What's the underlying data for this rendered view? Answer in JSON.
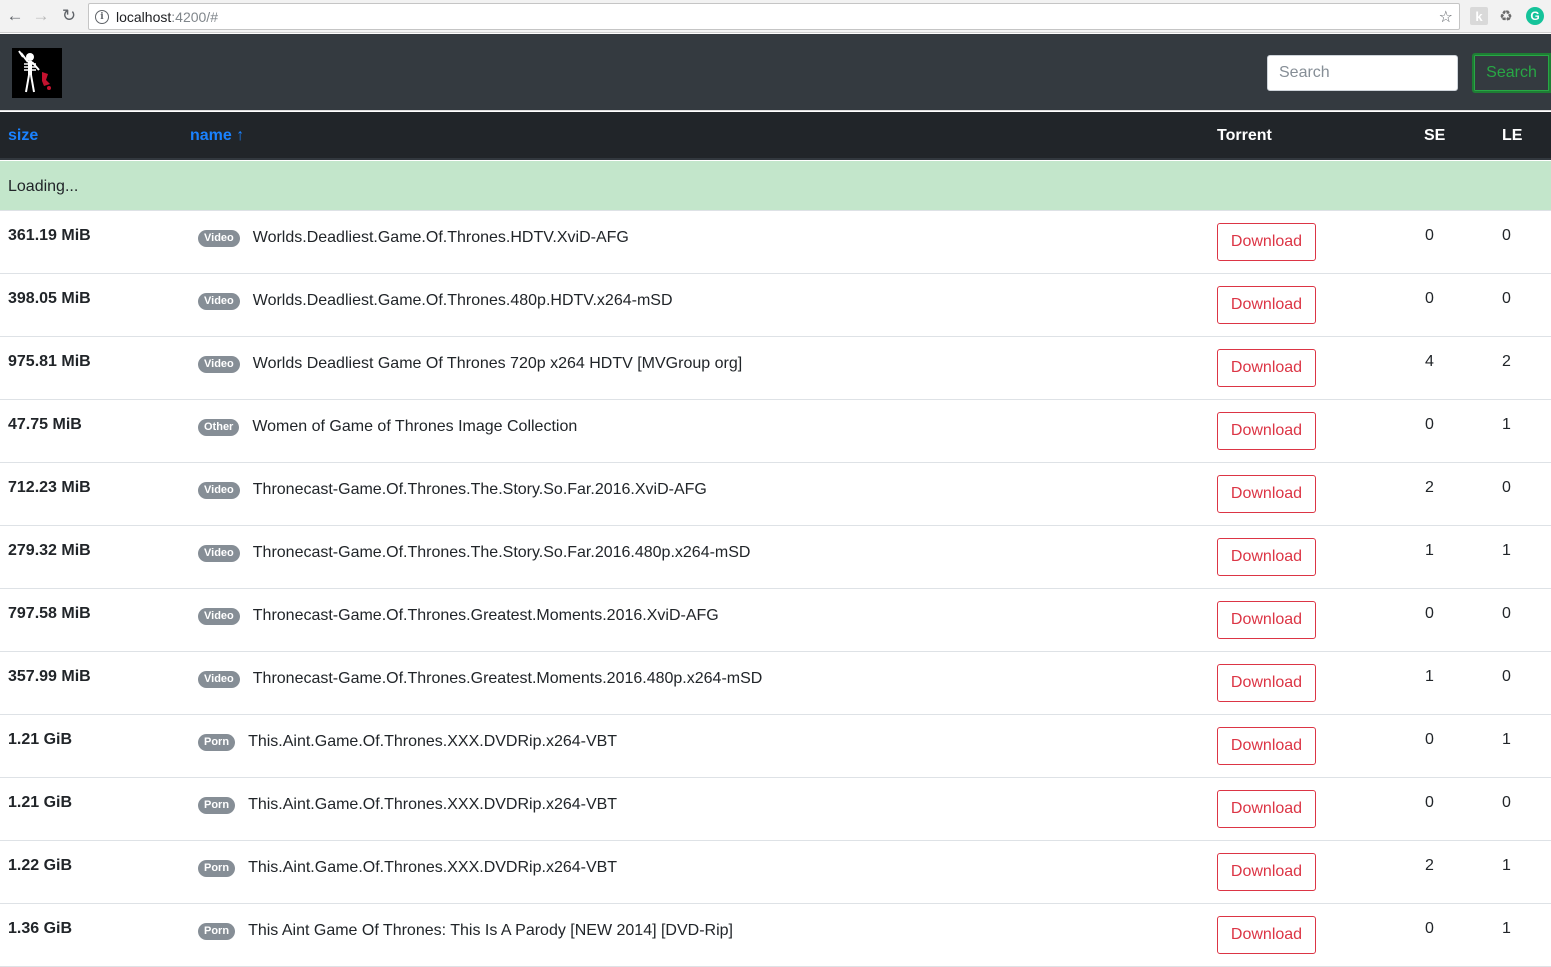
{
  "browser": {
    "url_host": "localhost",
    "url_path": ":4200/#"
  },
  "navbar": {
    "search_placeholder": "Search",
    "search_button": "Search"
  },
  "table": {
    "headers": {
      "size": "size",
      "name": "name ↑",
      "torrent": "Torrent",
      "se": "SE",
      "le": "LE"
    },
    "loading": "Loading...",
    "download_label": "Download",
    "rows": [
      {
        "size": "361.19 MiB",
        "category": "Video",
        "name": "Worlds.Deadliest.Game.Of.Thrones.HDTV.XviD-AFG",
        "se": "0",
        "le": "0"
      },
      {
        "size": "398.05 MiB",
        "category": "Video",
        "name": "Worlds.Deadliest.Game.Of.Thrones.480p.HDTV.x264-mSD",
        "se": "0",
        "le": "0"
      },
      {
        "size": "975.81 MiB",
        "category": "Video",
        "name": "Worlds Deadliest Game Of Thrones 720p x264 HDTV [MVGroup org]",
        "se": "4",
        "le": "2"
      },
      {
        "size": "47.75 MiB",
        "category": "Other",
        "name": "Women of Game of Thrones Image Collection",
        "se": "0",
        "le": "1"
      },
      {
        "size": "712.23 MiB",
        "category": "Video",
        "name": "Thronecast-Game.Of.Thrones.The.Story.So.Far.2016.XviD-AFG",
        "se": "2",
        "le": "0"
      },
      {
        "size": "279.32 MiB",
        "category": "Video",
        "name": "Thronecast-Game.Of.Thrones.The.Story.So.Far.2016.480p.x264-mSD",
        "se": "1",
        "le": "1"
      },
      {
        "size": "797.58 MiB",
        "category": "Video",
        "name": "Thronecast-Game.Of.Thrones.Greatest.Moments.2016.XviD-AFG",
        "se": "0",
        "le": "0"
      },
      {
        "size": "357.99 MiB",
        "category": "Video",
        "name": "Thronecast-Game.Of.Thrones.Greatest.Moments.2016.480p.x264-mSD",
        "se": "1",
        "le": "0"
      },
      {
        "size": "1.21 GiB",
        "category": "Porn",
        "name": "This.Aint.Game.Of.Thrones.XXX.DVDRip.x264-VBT",
        "se": "0",
        "le": "1"
      },
      {
        "size": "1.21 GiB",
        "category": "Porn",
        "name": "This.Aint.Game.Of.Thrones.XXX.DVDRip.x264-VBT",
        "se": "0",
        "le": "0"
      },
      {
        "size": "1.22 GiB",
        "category": "Porn",
        "name": "This.Aint.Game.Of.Thrones.XXX.DVDRip.x264-VBT",
        "se": "2",
        "le": "1"
      },
      {
        "size": "1.36 GiB",
        "category": "Porn",
        "name": "This Aint Game Of Thrones: This Is A Parody [NEW 2014] [DVD-Rip]",
        "se": "0",
        "le": "1"
      }
    ]
  }
}
